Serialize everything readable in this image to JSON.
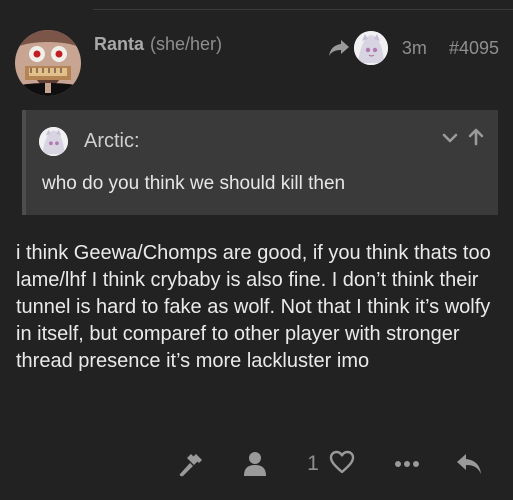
{
  "post": {
    "username": "Ranta",
    "pronouns": "(she/her)",
    "timestamp": "3m",
    "post_number": "#4095"
  },
  "quote": {
    "username": "Arctic:",
    "text": "who do you think we should kill then"
  },
  "body": {
    "text": "i think Geewa/Chomps are good, if you think thats too lame/lhf I think crybaby is also fine. I don’t think their tunnel is hard to fake as wolf. Not that I think it’s wolfy in itself, but comparef to other player with stronger thread presence it’s more lackluster imo"
  },
  "actions": {
    "like_count": "1"
  },
  "icons": {
    "reply_to": "share-arrow-icon",
    "quote_expand": "chevron-down-icon",
    "quote_jump": "arrow-up-icon",
    "admin": "hammer-icon",
    "user": "user-icon",
    "like": "heart-icon",
    "more": "ellipsis-icon",
    "reply": "reply-icon"
  },
  "colors": {
    "background": "#222222",
    "quote_background": "#3a3a3a",
    "text": "#eaeaea",
    "muted": "#8f8f8f",
    "icon": "#9a9a9a"
  }
}
